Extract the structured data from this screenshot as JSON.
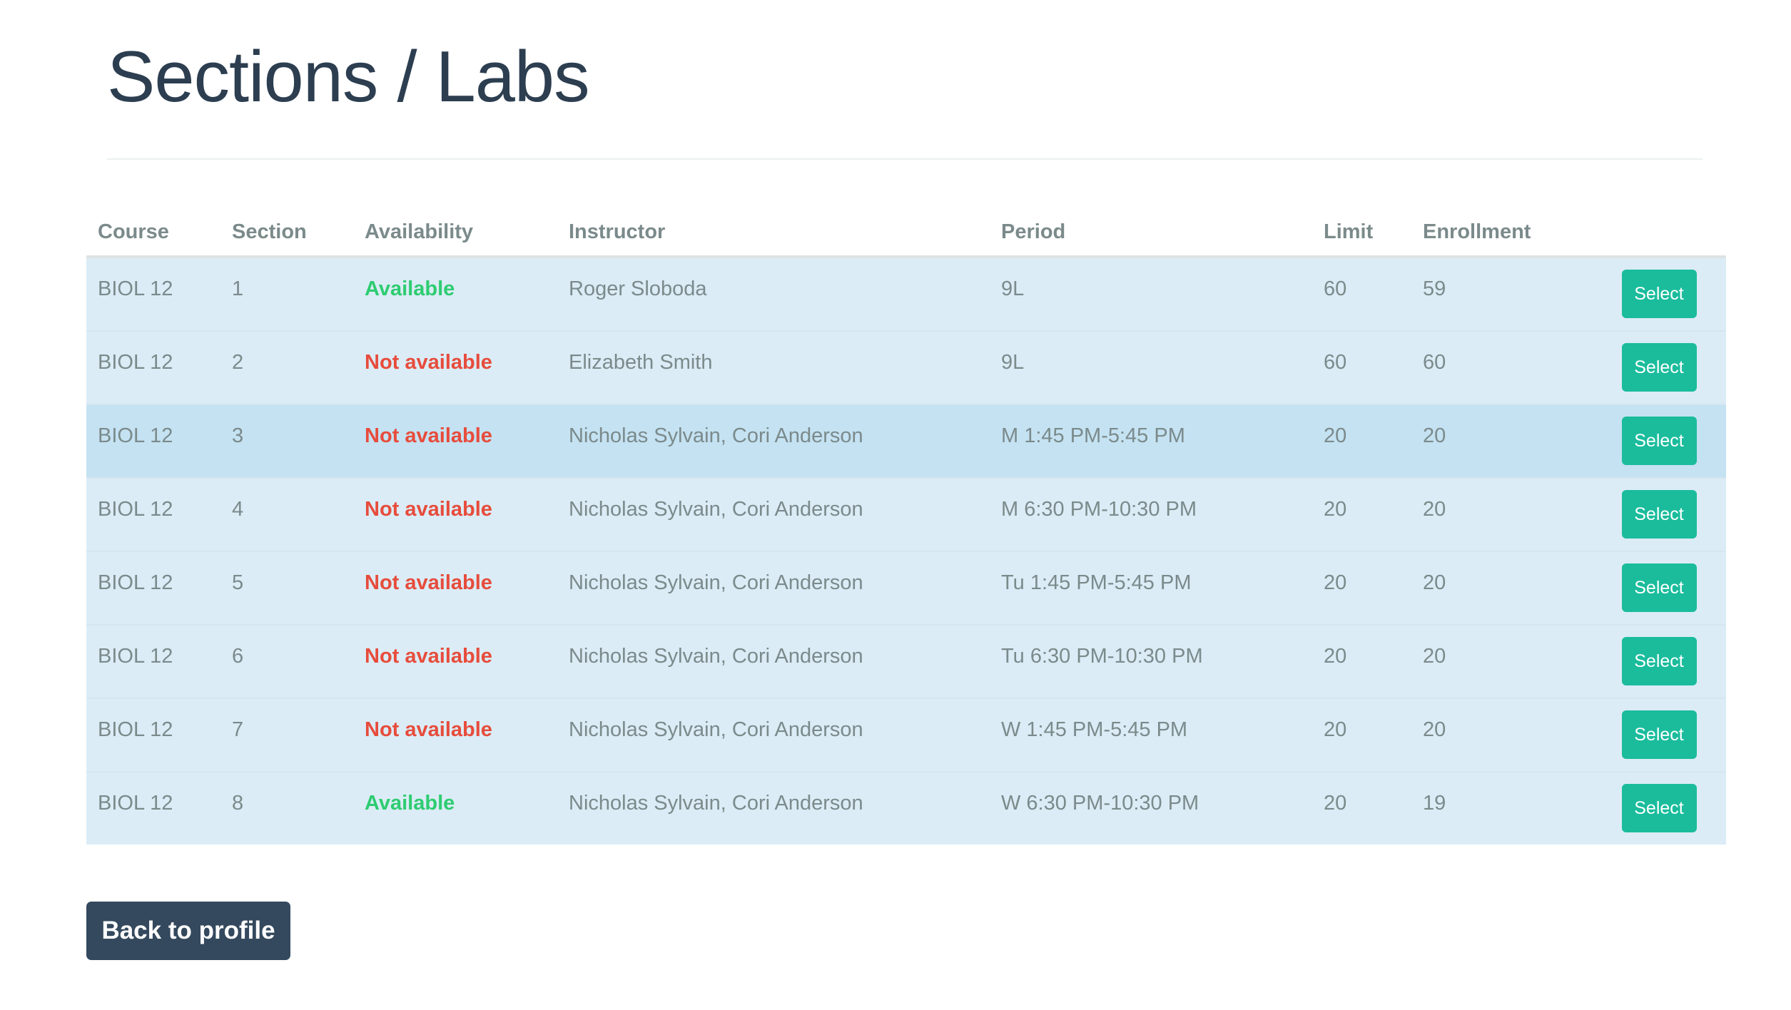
{
  "page": {
    "title": "Sections / Labs"
  },
  "colors": {
    "available": "#2ecc71",
    "not_available": "#e74c3c",
    "select_button": "#1abc9c",
    "back_button": "#34495e",
    "row_background": "#dbecf6",
    "row_hover_background": "#c4e2f2"
  },
  "table": {
    "columns": [
      "Course",
      "Section",
      "Availability",
      "Instructor",
      "Period",
      "Limit",
      "Enrollment",
      ""
    ],
    "rows": [
      {
        "course": "BIOL 12",
        "section": "1",
        "availability": "Available",
        "available": true,
        "instructor": "Roger Sloboda",
        "period": "9L",
        "limit": "60",
        "enrollment": "59",
        "action": "Select",
        "hovered": false
      },
      {
        "course": "BIOL 12",
        "section": "2",
        "availability": "Not available",
        "available": false,
        "instructor": "Elizabeth Smith",
        "period": "9L",
        "limit": "60",
        "enrollment": "60",
        "action": "Select",
        "hovered": false
      },
      {
        "course": "BIOL 12",
        "section": "3",
        "availability": "Not available",
        "available": false,
        "instructor": "Nicholas Sylvain, Cori Anderson",
        "period": "M 1:45 PM-5:45 PM",
        "limit": "20",
        "enrollment": "20",
        "action": "Select",
        "hovered": true
      },
      {
        "course": "BIOL 12",
        "section": "4",
        "availability": "Not available",
        "available": false,
        "instructor": "Nicholas Sylvain, Cori Anderson",
        "period": "M 6:30 PM-10:30 PM",
        "limit": "20",
        "enrollment": "20",
        "action": "Select",
        "hovered": false
      },
      {
        "course": "BIOL 12",
        "section": "5",
        "availability": "Not available",
        "available": false,
        "instructor": "Nicholas Sylvain, Cori Anderson",
        "period": "Tu 1:45 PM-5:45 PM",
        "limit": "20",
        "enrollment": "20",
        "action": "Select",
        "hovered": false
      },
      {
        "course": "BIOL 12",
        "section": "6",
        "availability": "Not available",
        "available": false,
        "instructor": "Nicholas Sylvain, Cori Anderson",
        "period": "Tu 6:30 PM-10:30 PM",
        "limit": "20",
        "enrollment": "20",
        "action": "Select",
        "hovered": false
      },
      {
        "course": "BIOL 12",
        "section": "7",
        "availability": "Not available",
        "available": false,
        "instructor": "Nicholas Sylvain, Cori Anderson",
        "period": "W 1:45 PM-5:45 PM",
        "limit": "20",
        "enrollment": "20",
        "action": "Select",
        "hovered": false
      },
      {
        "course": "BIOL 12",
        "section": "8",
        "availability": "Available",
        "available": true,
        "instructor": "Nicholas Sylvain, Cori Anderson",
        "period": "W 6:30 PM-10:30 PM",
        "limit": "20",
        "enrollment": "19",
        "action": "Select",
        "hovered": false
      }
    ]
  },
  "footer": {
    "back_label": "Back to profile"
  }
}
